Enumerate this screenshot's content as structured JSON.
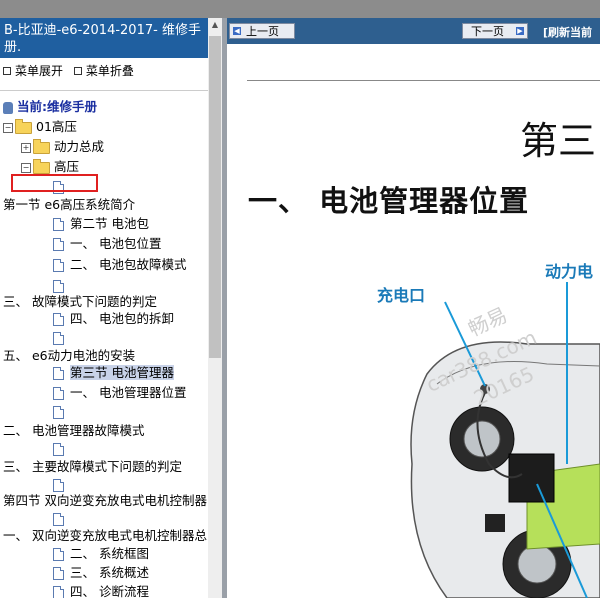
{
  "window": {
    "left_title": "B-比亚迪-e6-2014-2017- 维修手册.",
    "menu_expand": "菜单展开",
    "menu_collapse": "菜单折叠"
  },
  "tree": {
    "current_label": "当前:维修手册",
    "items": [
      {
        "text": "01高压"
      },
      {
        "text": "动力总成"
      },
      {
        "text": "高压"
      },
      {
        "text": ""
      },
      {
        "text": "第一节 e6高压系统简介"
      },
      {
        "text": "第二节 电池包"
      },
      {
        "text": "一、 电池包位置"
      },
      {
        "text": "二、 电池包故障模式"
      },
      {
        "text": ""
      },
      {
        "text": "三、 故障模式下问题的判定"
      },
      {
        "text": "四、 电池包的拆卸"
      },
      {
        "text": ""
      },
      {
        "text": "五、 e6动力电池的安装"
      },
      {
        "text": "第三节 电池管理器"
      },
      {
        "text": "一、 电池管理器位置"
      },
      {
        "text": ""
      },
      {
        "text": "二、 电池管理器故障模式"
      },
      {
        "text": ""
      },
      {
        "text": "三、 主要故障模式下问题的判定"
      },
      {
        "text": ""
      },
      {
        "text": "第四节 双向逆变充放电式电机控制器"
      },
      {
        "text": ""
      },
      {
        "text": "一、 双向逆变充放电式电机控制器总"
      },
      {
        "text": "二、 系统框图"
      },
      {
        "text": "三、 系统概述"
      },
      {
        "text": "四、 诊断流程"
      }
    ]
  },
  "nav": {
    "prev_label": "上一页",
    "next_label": "下一页",
    "refresh_label": "[刷新当前"
  },
  "content": {
    "chapter_title": "第三",
    "section_heading": "一、 电池管理器位置",
    "label_charge_port": "充电口",
    "label_power": "动力电",
    "watermark_1": "畅易",
    "watermark_2": "car388.com",
    "watermark_3": "20165"
  },
  "colors": {
    "title_bar": "#1f5fa0",
    "nav_bar": "#2e5f8f",
    "highlight_box": "#e02020",
    "label_blue": "#1a7ab8"
  }
}
